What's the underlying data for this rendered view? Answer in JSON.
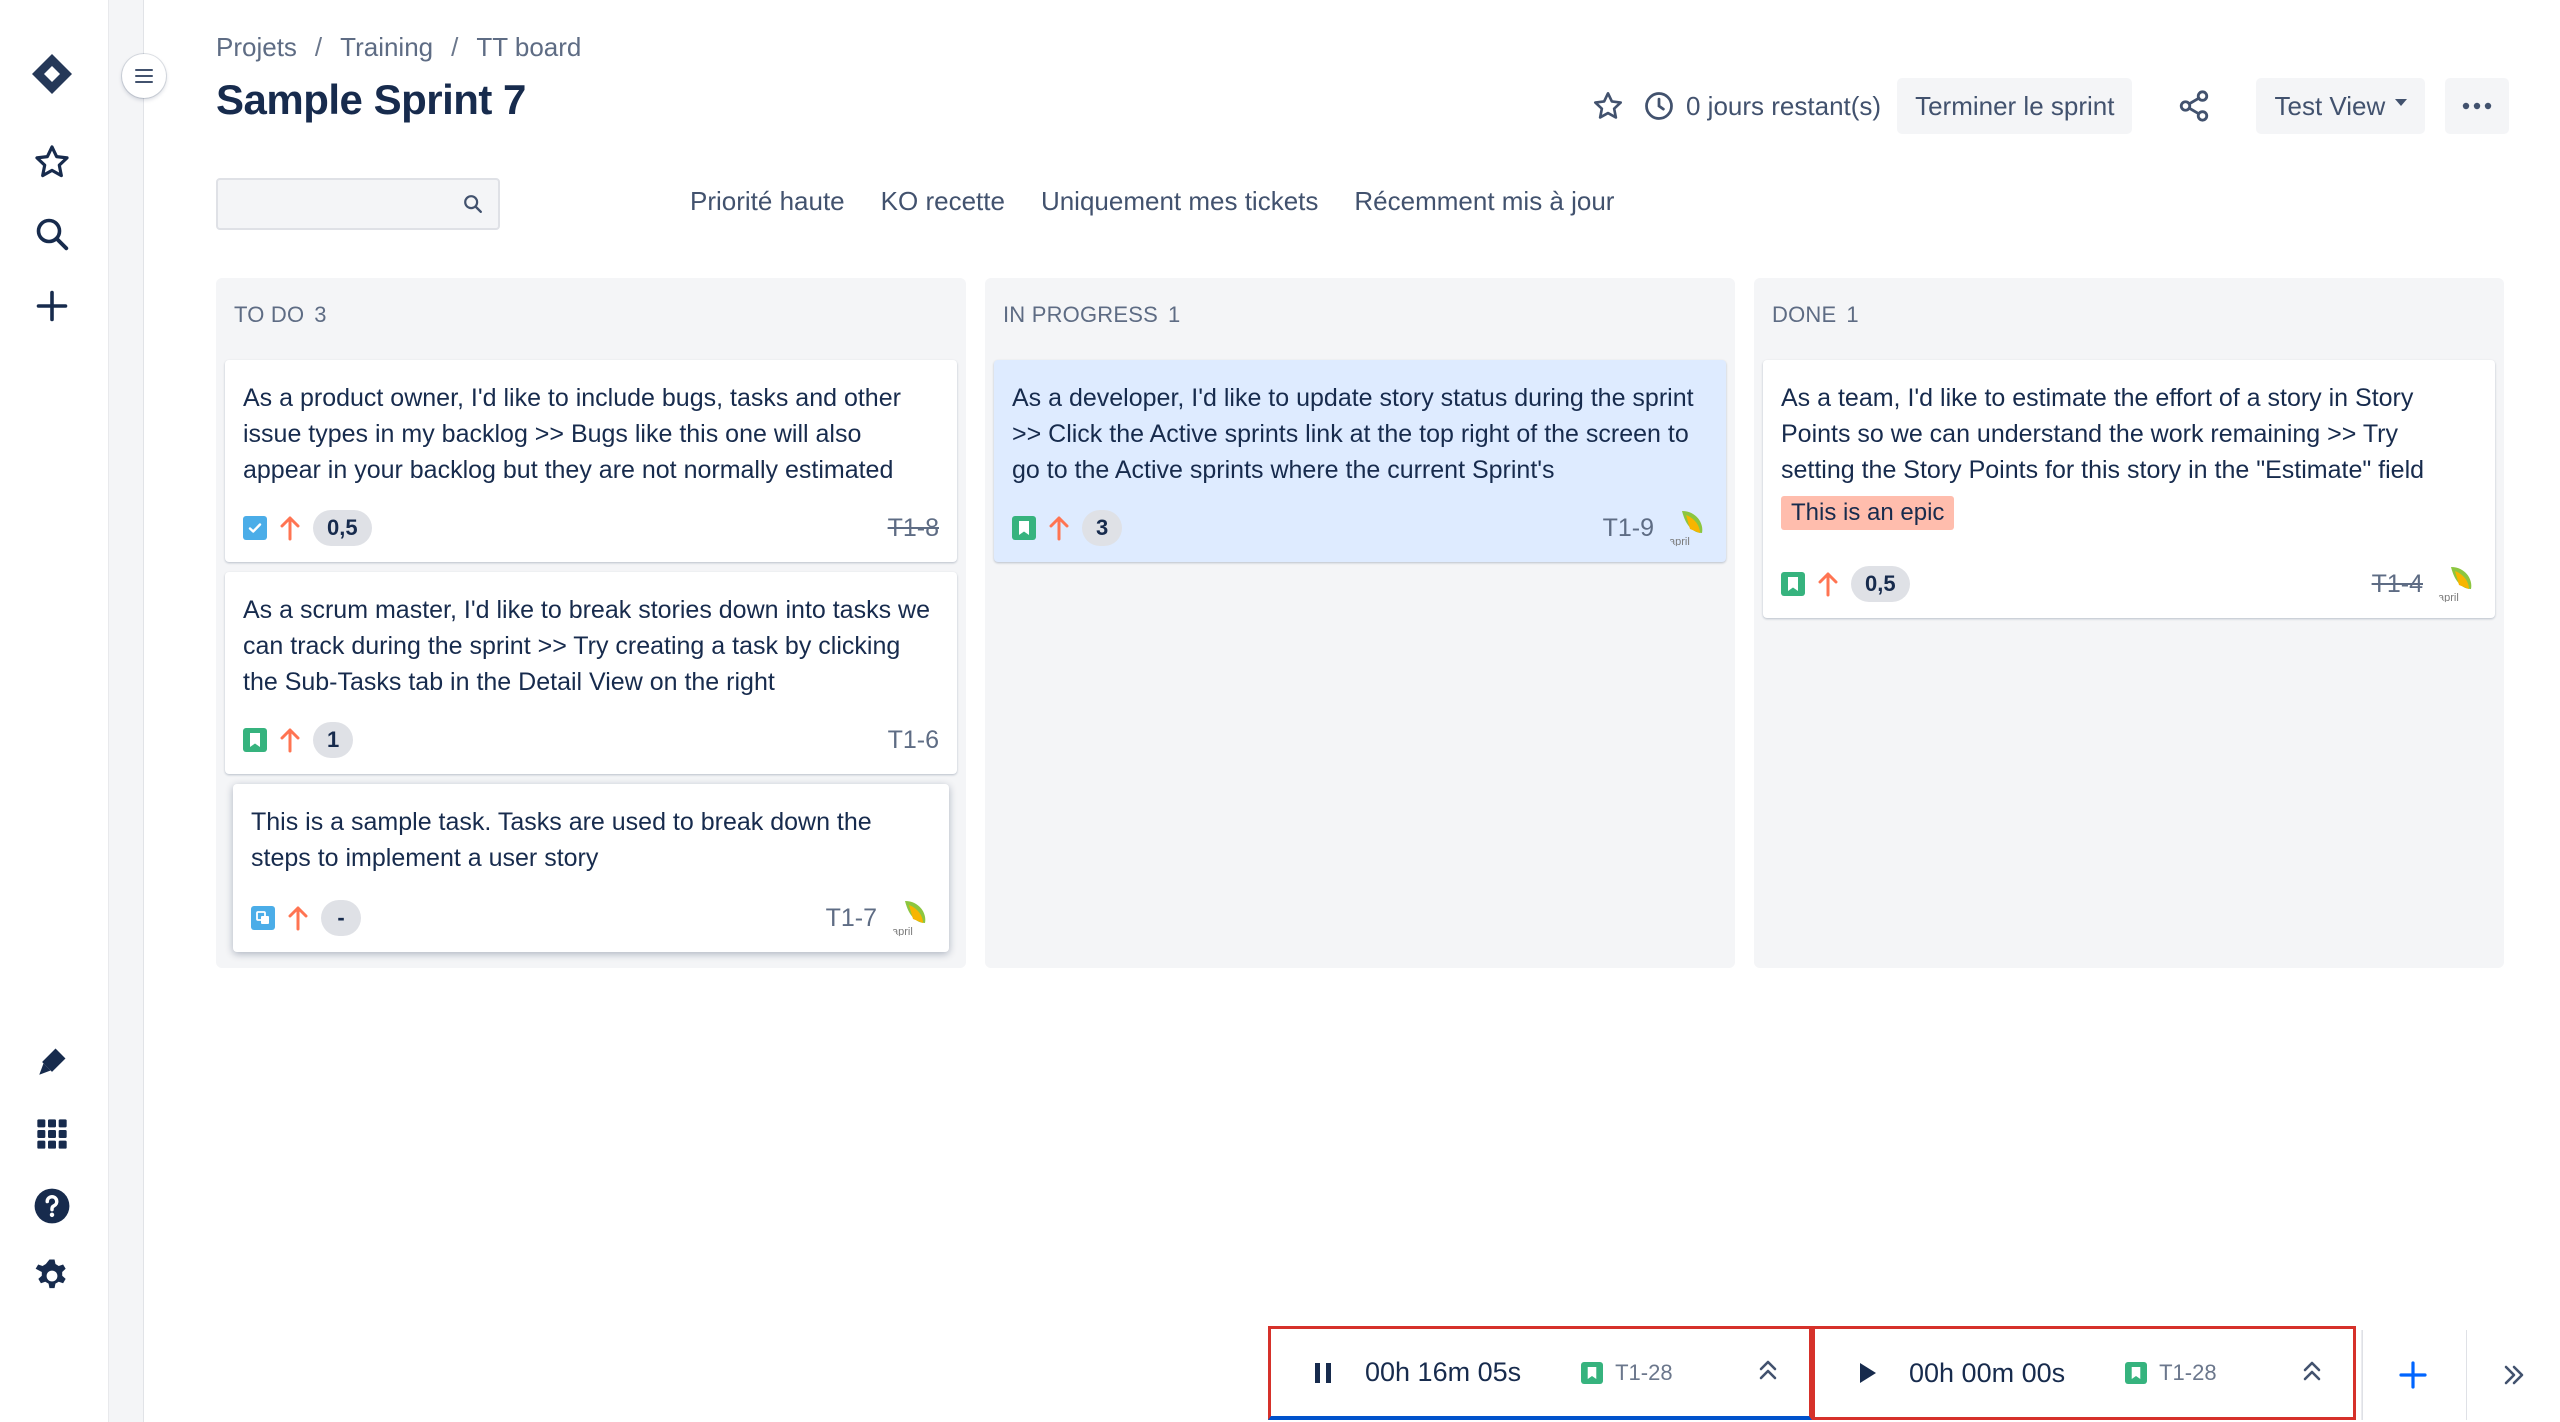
{
  "breadcrumb": {
    "items": [
      "Projets",
      "Training",
      "TT board"
    ],
    "separator": "/"
  },
  "title": "Sample Sprint 7",
  "header": {
    "days_left": "0 jours restant(s)",
    "end_sprint": "Terminer le sprint",
    "view": "Test View"
  },
  "search": {
    "value": "",
    "placeholder": ""
  },
  "quick_filters": [
    "Priorité haute",
    "KO recette",
    "Uniquement mes tickets",
    "Récemment mis à jour"
  ],
  "columns": [
    {
      "name": "TO DO",
      "count": "3",
      "cards": [
        {
          "summary": "As a product owner, I'd like to include bugs, tasks and other issue types in my backlog >> Bugs like this one will also appear in your backlog but they are not normally estimated",
          "type_icon": "task-checkbox-icon",
          "points": "0,5",
          "key": "T1-8"
        },
        {
          "summary": "As a scrum master, I'd like to break stories down into tasks we can track during the sprint >> Try creating a task by clicking the Sub-Tasks tab in the Detail View on the right",
          "type_icon": "story-bookmark-icon",
          "points": "1",
          "key": "T1-6"
        },
        {
          "summary": "This is a sample task. Tasks are used to break down the steps to implement a user story",
          "type_icon": "subtask-icon",
          "points": "-",
          "key": "T1-7"
        }
      ]
    },
    {
      "name": "IN PROGRESS",
      "count": "1",
      "cards": [
        {
          "summary": "As a developer, I'd like to update story status during the sprint >> Click the Active sprints link at the top right of the screen to go to the Active sprints where the current Sprint's",
          "type_icon": "story-bookmark-icon",
          "points": "3",
          "key": "T1-9"
        }
      ]
    },
    {
      "name": "DONE",
      "count": "1",
      "cards": [
        {
          "summary": "As a team, I'd like to estimate the effort of a story in Story Points so we can understand the work remaining >> Try setting the Story Points for this story in the \"Estimate\" field",
          "epic": "This is an epic",
          "type_icon": "story-bookmark-icon",
          "points": "0,5",
          "key": "T1-4"
        }
      ]
    }
  ],
  "timers": [
    {
      "time": "00h 16m 05s",
      "issue": "T1-28",
      "state": "running"
    },
    {
      "time": "00h 00m 00s",
      "issue": "T1-28",
      "state": "paused"
    }
  ],
  "colors": {
    "story": "#36b37e",
    "task": "#4bade8",
    "priority_high": "#ff7452",
    "epic": "#ffbdad",
    "timer_border": "#d6312a",
    "accent": "#0052cc"
  }
}
